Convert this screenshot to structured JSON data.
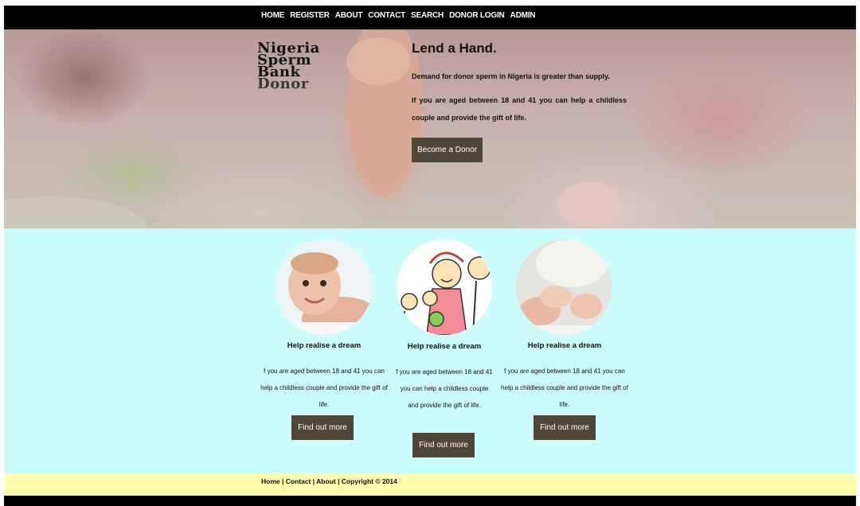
{
  "nav": {
    "items": [
      "HOME",
      "REGISTER",
      "ABOUT",
      "CONTACT",
      "SEARCH",
      "DONOR LOGIN",
      "ADMIN"
    ]
  },
  "logo": {
    "lines": [
      "Nigeria",
      "Sperm",
      "Bank",
      "Donor"
    ]
  },
  "hero": {
    "title": "Lend a Hand.",
    "paragraph1": "Demand for donor sperm in Nigeria is greater than supply.",
    "paragraph2": "If you are aged between 18 and 41 you can help a childless couple and provide the gift of life.",
    "button": "Become a Donor"
  },
  "features": [
    {
      "image": "baby-face-photo",
      "heading": "Help realise a dream",
      "text": "f you are aged between 18 and 41 you can help a childless couple and provide the gift of life.",
      "button": "Find out more"
    },
    {
      "image": "family-drawing",
      "heading": "Help realise a dream",
      "text": "f you are aged between 18 and 41 you can help a childless couple and provide the gift of life.",
      "button": "Find out more"
    },
    {
      "image": "baby-feet-photo",
      "heading": "Help realise a dream",
      "text": "f you are aged between 18 and 41 you can help a childless couple and provide the gift of life.",
      "button": "Find out more"
    }
  ],
  "footer": {
    "links": [
      "Home",
      "Contact",
      "About"
    ],
    "separator": " | ",
    "copyright": "Copyright © 2014"
  },
  "colors": {
    "nav_bg": "#000000",
    "features_bg": "#ccfcfb",
    "footer_bg": "#fffdb0",
    "button_bg": "#4e4638"
  }
}
